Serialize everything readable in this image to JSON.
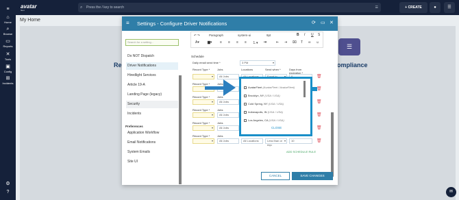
{
  "app": {
    "logo": "avatar",
    "logo_sub": "fleet",
    "search_placeholder": "Press the / key to search",
    "create_label": "CREATE"
  },
  "nav": [
    {
      "label": "Home",
      "icon": "home-icon"
    },
    {
      "label": "Browse",
      "icon": "search-icon"
    },
    {
      "label": "Reports",
      "icon": "folder-icon"
    },
    {
      "label": "Tools",
      "icon": "tools-icon"
    },
    {
      "label": "Config",
      "icon": "config-icon"
    },
    {
      "label": "Incidents",
      "icon": "incidents-icon"
    }
  ],
  "page": {
    "title": "My Home",
    "bg_left": "Re",
    "bg_right": "ompliance"
  },
  "dialog": {
    "title": "Settings - Configure Driver Notifications",
    "side_search_placeholder": "Search for a setting...",
    "side_items": [
      "Do NOT Dispatch",
      "Driver Notifications",
      "Hiredlight Services",
      "Article 19-A",
      "Landing Page (legacy)",
      "Security",
      "Incidents"
    ],
    "preferences_heading": "Preferences",
    "pref_items": [
      "Application Workflow",
      "Email Notifications",
      "System Emails",
      "Site UI"
    ],
    "toolbar": {
      "format": "Paragraph",
      "font": "system-ui",
      "size": "9pt"
    },
    "schedule_label": "Schedule",
    "daily_email_label": "Daily email send time *",
    "daily_email_value": "3 PM",
    "col_record_type": "Record Type *",
    "col_jobs": "Jobs",
    "col_locations": "Locations",
    "col_send_when": "Send when *",
    "col_days_expiration": "Days from expiration *",
    "row1_jobs": "All Jobs",
    "row1_locations": "All Locations",
    "row1_send": "Equal to",
    "row1_days": "0",
    "row_jobs": "All Jobs",
    "last_locations": "All Locations",
    "last_send": "Less than or equ",
    "last_days": "10",
    "add_schedule_rule": "ADD SCHEDULE RULE",
    "cancel": "CANCEL",
    "save": "SAVE CHANGES",
    "popup": {
      "items": [
        {
          "name": "AvatarFleet",
          "detail": "(AvatarFleet / AvatarFleet)"
        },
        {
          "name": "Brooklyn, NY",
          "detail": "(USA / USA)"
        },
        {
          "name": "Cold Spring, NY",
          "detail": "(USA / USA)"
        },
        {
          "name": "Indianapolis, IN",
          "detail": "(USA / USA)"
        },
        {
          "name": "Los Angeles, CA",
          "detail": "(USA / USA)"
        }
      ],
      "close": "CLOSE"
    }
  }
}
